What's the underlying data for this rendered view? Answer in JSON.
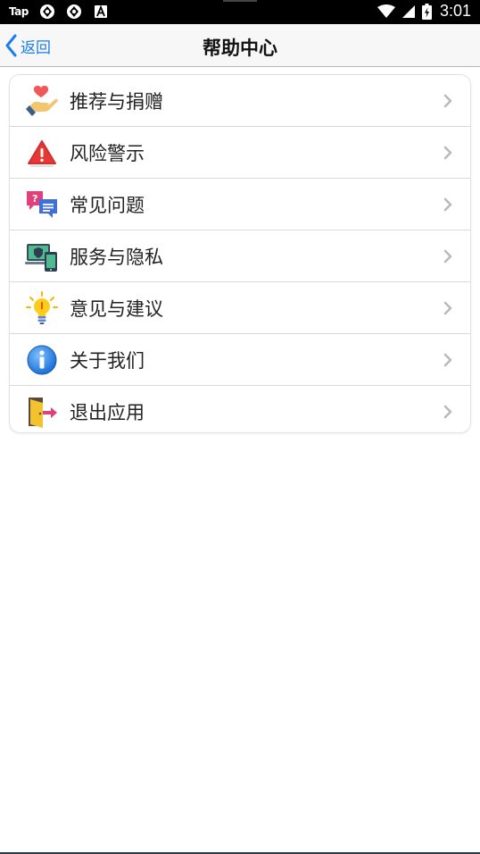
{
  "status_bar": {
    "carrier_label": "Tap",
    "time": "3:01",
    "icons": [
      "sync-icon",
      "sync-icon",
      "font-icon",
      "wifi-icon",
      "signal-icon",
      "battery-icon"
    ]
  },
  "nav": {
    "back_label": "返回",
    "title": "帮助中心"
  },
  "menu": {
    "items": [
      {
        "label": "推荐与捐赠",
        "icon": "donate-heart-icon"
      },
      {
        "label": "风险警示",
        "icon": "warning-icon"
      },
      {
        "label": "常见问题",
        "icon": "faq-chat-icon"
      },
      {
        "label": "服务与隐私",
        "icon": "privacy-device-icon"
      },
      {
        "label": "意见与建议",
        "icon": "lightbulb-icon"
      },
      {
        "label": "关于我们",
        "icon": "info-icon"
      },
      {
        "label": "退出应用",
        "icon": "exit-door-icon"
      }
    ]
  },
  "colors": {
    "accent": "#1a7ef0",
    "nav_bg": "#f7f7f7",
    "status_bar_bg": "#000000",
    "separator": "#d9d9d9"
  }
}
